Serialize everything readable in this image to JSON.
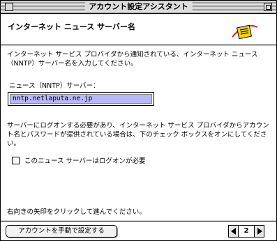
{
  "window": {
    "title": "アカウント設定アシスタント"
  },
  "header": {
    "heading": "インターネット ニュース サーバー名",
    "logo_icon": "news-globe-icon"
  },
  "content": {
    "intro": "インターネット サービス プロバイダから通知されている、インターネット ニュース（NNTP）サーバー名を入力してください。",
    "field_label": "ニュース（NNTP）サーバー：",
    "field_value": "nntp.netlaputa.ne.jp",
    "auth_note": "サーバーにログオンする必要があり、インターネット サービス プロバイダからアカウント名とパスワードが提供されている場合は、下のチェック ボックスをオンにしてください。",
    "checkbox_label": "このニュース サーバーはログオンが必要",
    "checkbox_checked": false,
    "hint": "右向きの矢印をクリックして進んでください。"
  },
  "footer": {
    "manual_button": "アカウントを手動で設定する",
    "page_number": "2"
  },
  "colors": {
    "field_highlight": "#b8b8ff",
    "logo_yellow": "#f5d400",
    "logo_red": "#d42020"
  }
}
